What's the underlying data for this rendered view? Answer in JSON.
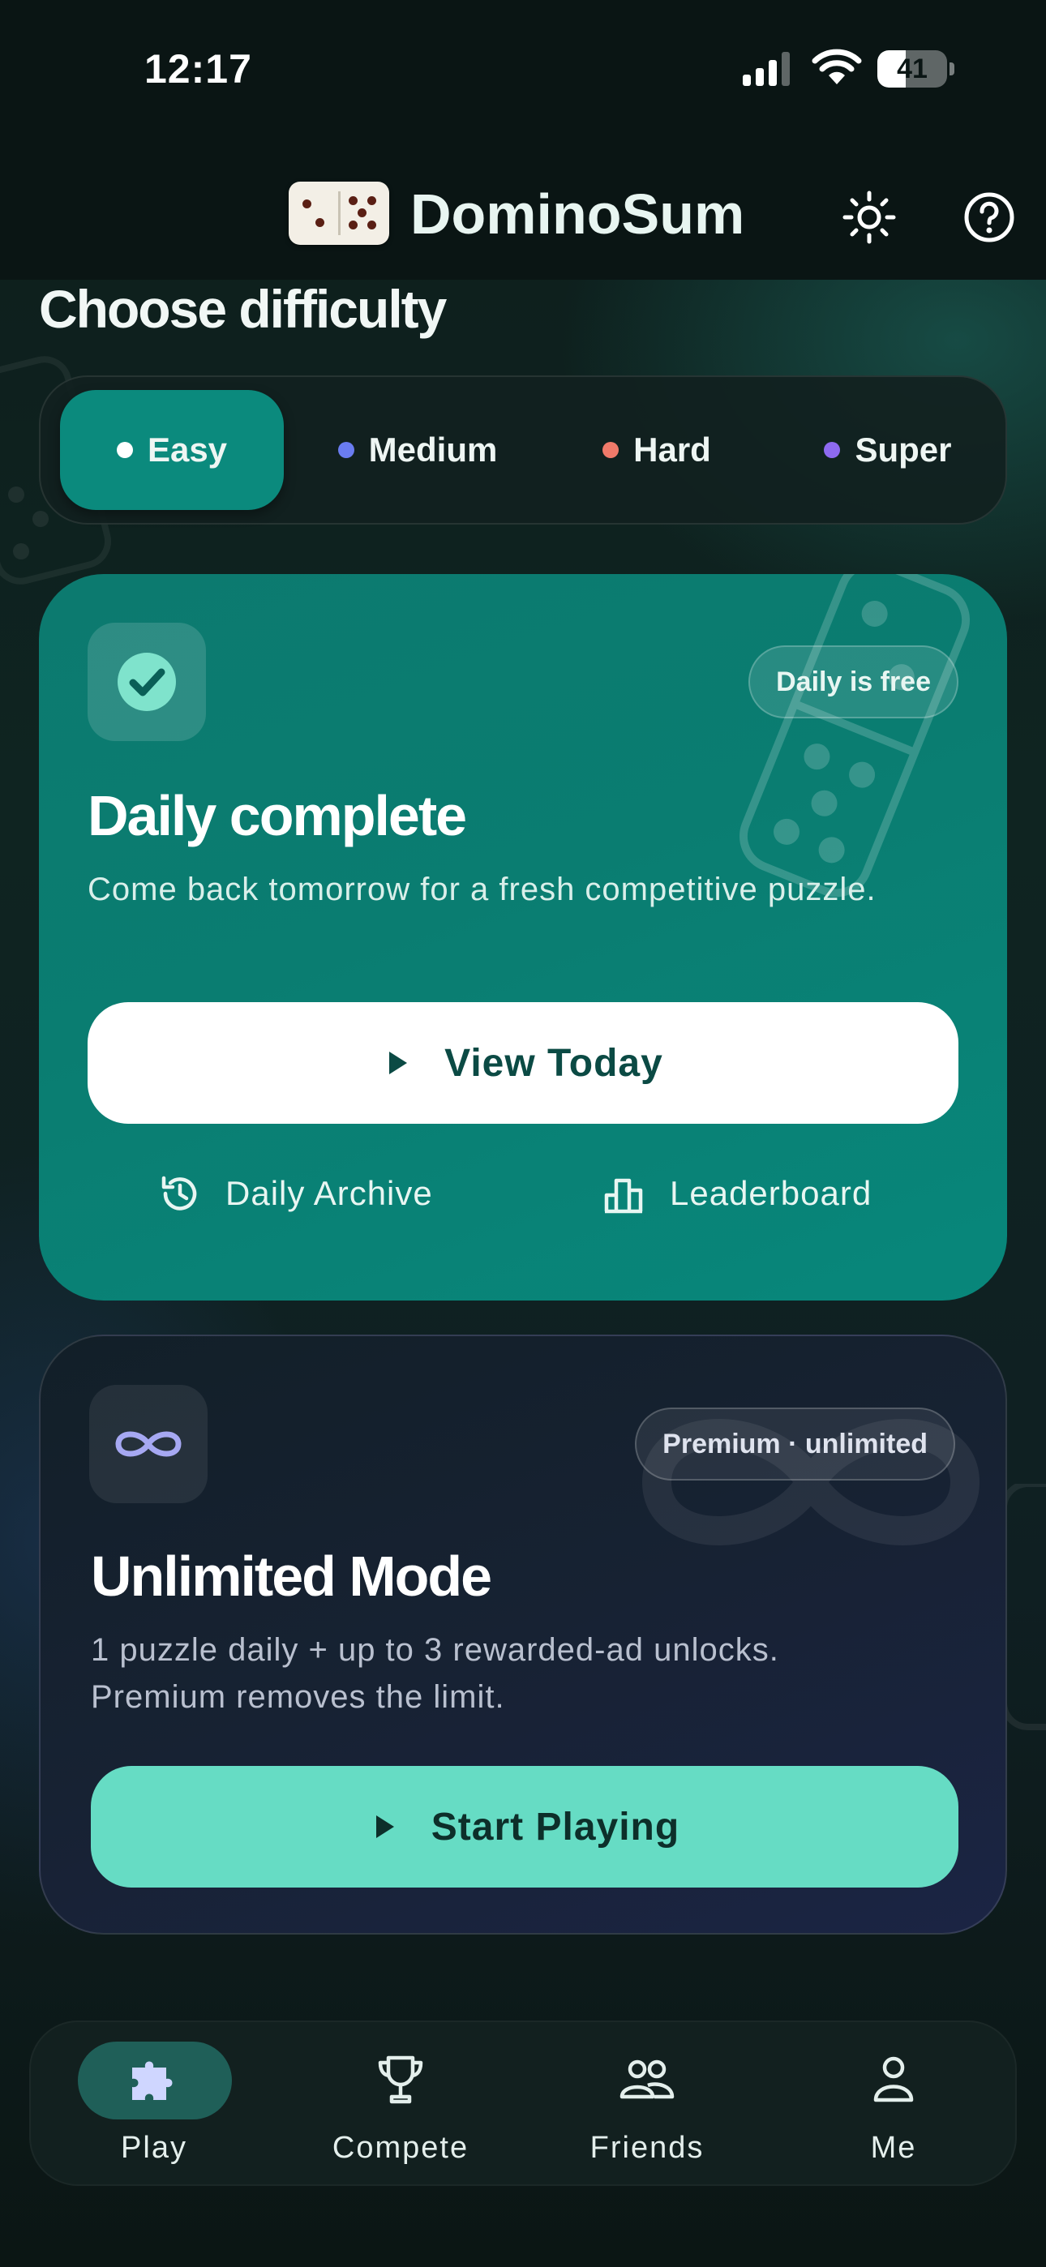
{
  "status_bar": {
    "time": "12:17",
    "battery": "41",
    "battery_level": 0.41
  },
  "header": {
    "app_title": "DominoSum"
  },
  "difficulty": {
    "title": "Choose difficulty",
    "options": [
      {
        "label": "Easy",
        "dot_color": "#ffffff",
        "active": true
      },
      {
        "label": "Medium",
        "dot_color": "#6a7cf0",
        "active": false
      },
      {
        "label": "Hard",
        "dot_color": "#f07a6a",
        "active": false
      },
      {
        "label": "Super",
        "dot_color": "#8e6af0",
        "active": false
      }
    ]
  },
  "daily_card": {
    "badge": "Daily is free",
    "title": "Daily complete",
    "description": "Come back tomorrow for a fresh competitive puzzle.",
    "primary_button": "View Today",
    "links": {
      "archive": "Daily Archive",
      "leaderboard": "Leaderboard"
    }
  },
  "unlimited_card": {
    "badge": "Premium · unlimited",
    "title": "Unlimited Mode",
    "description": "1 puzzle daily + up to 3 rewarded-ad unlocks. Premium removes the limit.",
    "primary_button": "Start Playing"
  },
  "bottom_nav": {
    "items": [
      {
        "label": "Play",
        "icon": "puzzle-icon",
        "active": true
      },
      {
        "label": "Compete",
        "icon": "trophy-icon",
        "active": false
      },
      {
        "label": "Friends",
        "icon": "friends-icon",
        "active": false
      },
      {
        "label": "Me",
        "icon": "person-icon",
        "active": false
      }
    ]
  },
  "colors": {
    "accent_teal": "#0b8a7d",
    "mint_button": "#66dcc4",
    "background": "#0b1614"
  }
}
